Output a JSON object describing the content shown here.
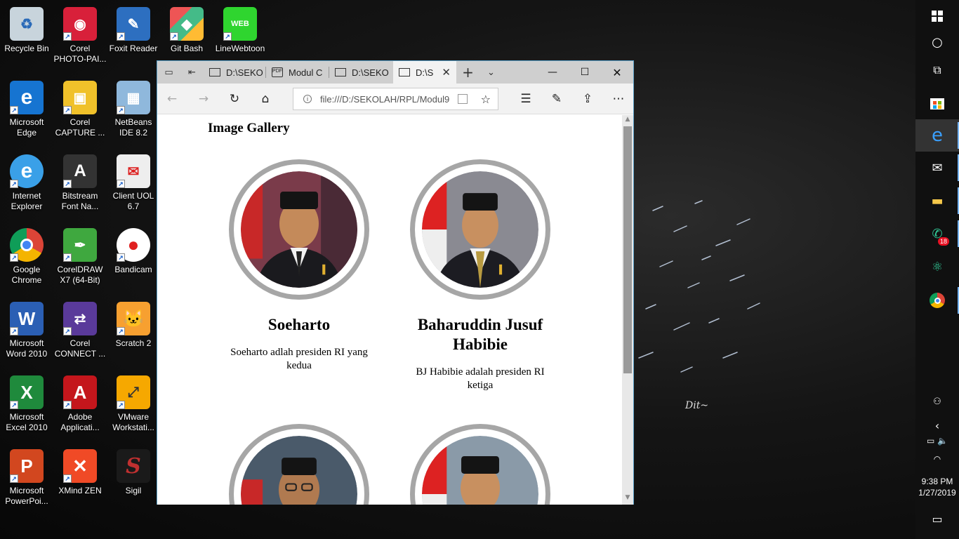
{
  "desktop": {
    "icons": [
      {
        "label": "Recycle Bin",
        "icon": "recycle-bin-icon"
      },
      {
        "label": "Corel PHOTO-PAI...",
        "icon": "corel-photopaint-icon"
      },
      {
        "label": "Foxit Reader",
        "icon": "foxit-reader-icon"
      },
      {
        "label": "Git Bash",
        "icon": "git-bash-icon"
      },
      {
        "label": "LineWebtoon",
        "icon": "linewebtoon-icon"
      },
      {
        "label": "Microsoft Edge",
        "icon": "microsoft-edge-icon"
      },
      {
        "label": "Corel CAPTURE ...",
        "icon": "corel-capture-icon"
      },
      {
        "label": "NetBeans IDE 8.2",
        "icon": "netbeans-icon"
      },
      {
        "label": "Internet Explorer",
        "icon": "internet-explorer-icon"
      },
      {
        "label": "Bitstream Font Na...",
        "icon": "bitstream-font-icon"
      },
      {
        "label": "Client UOL 6.7",
        "icon": "client-uol-icon"
      },
      {
        "label": "Google Chrome",
        "icon": "google-chrome-icon"
      },
      {
        "label": "CorelDRAW X7 (64-Bit)",
        "icon": "coreldraw-icon"
      },
      {
        "label": "Bandicam",
        "icon": "bandicam-icon"
      },
      {
        "label": "Microsoft Word 2010",
        "icon": "word-icon"
      },
      {
        "label": "Corel CONNECT ...",
        "icon": "corel-connect-icon"
      },
      {
        "label": "Scratch 2",
        "icon": "scratch-icon"
      },
      {
        "label": "Microsoft Excel 2010",
        "icon": "excel-icon"
      },
      {
        "label": "Adobe Applicati...",
        "icon": "adobe-icon"
      },
      {
        "label": "VMware Workstati...",
        "icon": "vmware-icon"
      },
      {
        "label": "Microsoft PowerPoi...",
        "icon": "powerpoint-icon"
      },
      {
        "label": "XMind ZEN",
        "icon": "xmind-icon"
      },
      {
        "label": "Sigil",
        "icon": "sigil-icon"
      }
    ],
    "signature": "Dit~"
  },
  "browser": {
    "tabs": [
      {
        "label": "D:\\SEKO",
        "icon": "page-icon"
      },
      {
        "label": "Modul C",
        "icon": "pdf-icon"
      },
      {
        "label": "D:\\SEKO",
        "icon": "page-icon"
      },
      {
        "label": "D:\\S",
        "icon": "page-icon",
        "active": true
      }
    ],
    "address": "file:///D:/SEKOLAH/RPL/Modul9"
  },
  "page": {
    "title": "Image Gallery",
    "cards": [
      {
        "name": "Soeharto",
        "desc": "Soeharto adlah presiden RI yang kedua"
      },
      {
        "name": "Baharuddin Jusuf Habibie",
        "desc": "BJ Habibie adalah presiden RI ketiga"
      }
    ]
  },
  "taskbar": {
    "notification_badge": "18",
    "time": "9:38 PM",
    "date": "1/27/2019"
  },
  "colors": {
    "desktop_bg": "#151515",
    "taskbar_bg": "#101010",
    "accent": "#7ab8ff",
    "portrait_ring": "#a6a6a6"
  }
}
